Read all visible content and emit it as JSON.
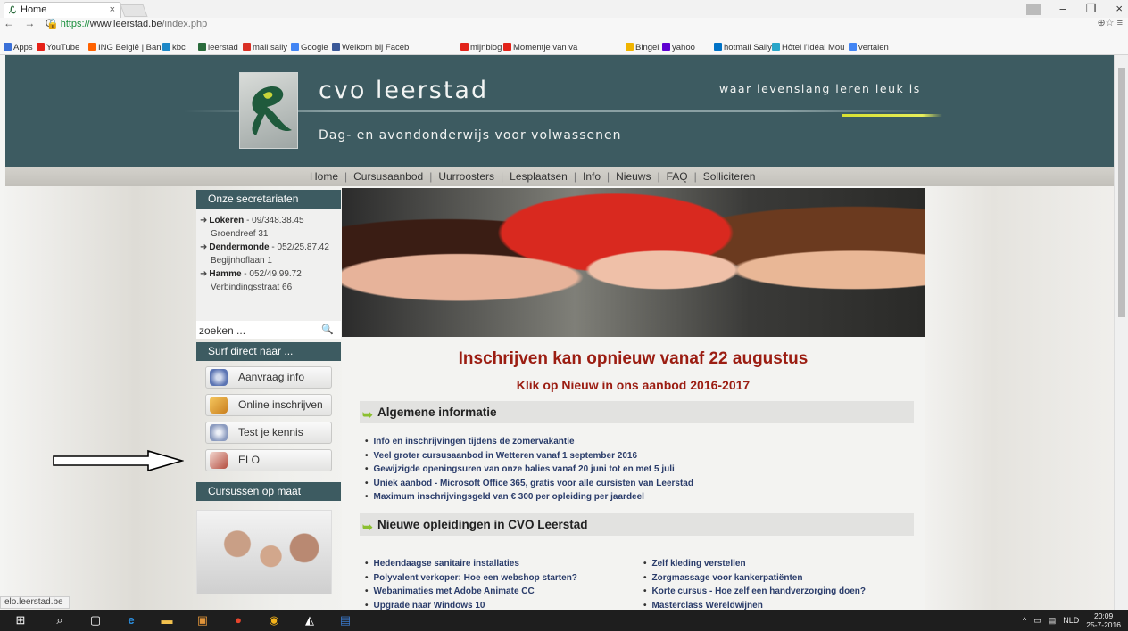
{
  "browser": {
    "tab_title": "Home",
    "tab_close": "×",
    "url_https": "https://",
    "url_host": "www.leerstad.be",
    "url_path": "/index.php",
    "nav_glyphs": "← → C",
    "addr_right": "⊕☆ ≡",
    "window_min": "–",
    "window_max": "❐",
    "window_close": "×",
    "bookmarks": [
      {
        "label": "Apps",
        "color": "#3a70d8"
      },
      {
        "label": "YouTube",
        "color": "#e62117"
      },
      {
        "label": "ING België | Bank",
        "color": "#ff6200"
      },
      {
        "label": "kbc",
        "color": "#1e88c7"
      },
      {
        "label": "leerstad",
        "color": "#2a6b3c"
      },
      {
        "label": "mail sally",
        "color": "#d93025"
      },
      {
        "label": "Google",
        "color": "#4285f4"
      },
      {
        "label": "Welkom bij Faceb",
        "color": "#3b5998"
      },
      {
        "label": "mijnblog",
        "color": "#e2231a"
      },
      {
        "label": "Momentje van va",
        "color": "#e2231a"
      },
      {
        "label": "Bingel",
        "color": "#f0b400"
      },
      {
        "label": "yahoo",
        "color": "#5f01d1"
      },
      {
        "label": "hotmail Sally",
        "color": "#0072c6"
      },
      {
        "label": "Hôtel l'Idéal Mou",
        "color": "#2aa6c9"
      },
      {
        "label": "vertalen",
        "color": "#4285f4"
      }
    ]
  },
  "site": {
    "name": "cvo leerstad",
    "subtitle": "Dag- en avondonderwijs voor volwassenen",
    "slogan_pre": "waar levenslang leren ",
    "slogan_u": "leuk",
    "slogan_post": " is",
    "menu": [
      "Home",
      "Cursusaanbod",
      "Uurroosters",
      "Lesplaatsen",
      "Info",
      "Nieuws",
      "FAQ",
      "Solliciteren"
    ],
    "menu_sep": "|"
  },
  "sidebar": {
    "secretariaten_title": "Onze secretariaten",
    "offices": [
      {
        "name": "Lokeren",
        "phone": " - 09/348.38.45",
        "street": "Groendreef 31"
      },
      {
        "name": "Dendermonde",
        "phone": " - 052/25.87.42",
        "street": "Begijnhoflaan 1"
      },
      {
        "name": "Hamme",
        "phone": " - 052/49.99.72",
        "street": "Verbindingsstraat 66"
      }
    ],
    "search_placeholder": "zoeken ...",
    "surf_title": "Surf direct naar ...",
    "buttons": [
      "Aanvraag info",
      "Online inschrijven",
      "Test je kennis",
      "ELO"
    ],
    "cursussen_title": "Cursussen op maat"
  },
  "main": {
    "headline": "Inschrijven kan opnieuw vanaf 22 augustus",
    "subheadline": "Klik op Nieuw in ons aanbod 2016-2017",
    "section1_title": "Algemene informatie",
    "section1_items": [
      "Info en inschrijvingen tijdens de zomervakantie",
      "Veel groter cursusaanbod in Wetteren vanaf 1 september 2016",
      "Gewijzigde openingsuren van onze balies vanaf 20 juni tot en met 5 juli",
      "Uniek aanbod - Microsoft Office 365, gratis voor alle cursisten van Leerstad",
      "Maximum inschrijvingsgeld van € 300 per opleiding per jaardeel"
    ],
    "section2_title": "Nieuwe opleidingen in CVO Leerstad",
    "section2_left": [
      "Hedendaagse sanitaire installaties",
      "Polyvalent verkoper: Hoe een webshop starten?",
      "Webanimaties met Adobe Animate CC",
      "Upgrade naar Windows 10"
    ],
    "section2_right": [
      "Zelf kleding verstellen",
      "Zorgmassage voor kankerpatiënten",
      "Korte cursus - Hoe zelf een handverzorging doen?",
      "Masterclass Wereldwijnen"
    ]
  },
  "statusbar": "elo.leerstad.be",
  "taskbar": {
    "lang": "NLD",
    "time": "20:09",
    "date": "25-7-2016"
  }
}
